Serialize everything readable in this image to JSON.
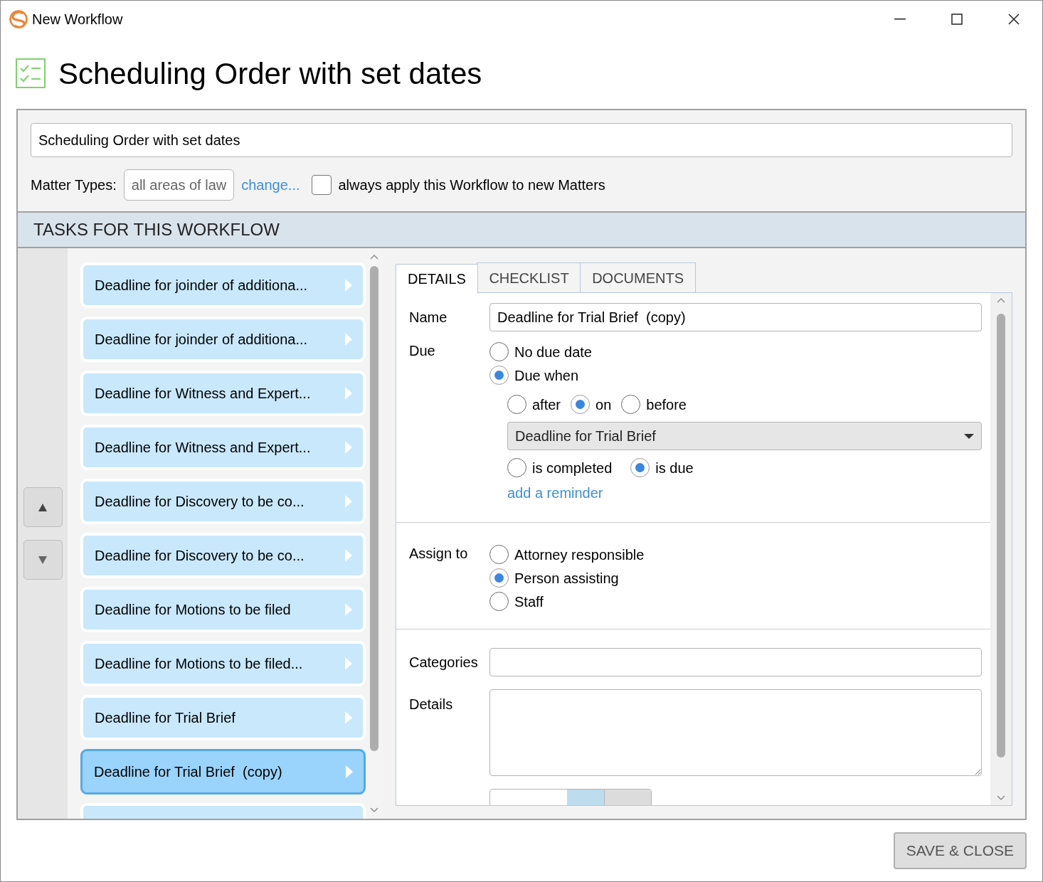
{
  "window": {
    "title": "New Workflow"
  },
  "heading": "Scheduling Order with set dates",
  "workflow_name": {
    "value": "Scheduling Order with set dates"
  },
  "matter_types": {
    "label": "Matter Types:",
    "value": "all areas of law",
    "change_link": "change...",
    "always_apply": {
      "label": "always apply this Workflow to new Matters",
      "checked": false
    }
  },
  "tasks_header": "TASKS FOR THIS WORKFLOW",
  "tasks": [
    {
      "label": "Deadline for joinder of additiona...",
      "selected": false
    },
    {
      "label": "Deadline for joinder of additiona...",
      "selected": false
    },
    {
      "label": "Deadline for Witness and Expert...",
      "selected": false
    },
    {
      "label": "Deadline for Witness and Expert...",
      "selected": false
    },
    {
      "label": "Deadline for Discovery to be co...",
      "selected": false
    },
    {
      "label": "Deadline for Discovery to be co...",
      "selected": false
    },
    {
      "label": "Deadline for Motions to be filed",
      "selected": false
    },
    {
      "label": "Deadline for Motions to be filed...",
      "selected": false
    },
    {
      "label": "Deadline for Trial Brief",
      "selected": false
    },
    {
      "label": "Deadline for Trial Brief  (copy)",
      "selected": true
    }
  ],
  "tabs": [
    {
      "label": "DETAILS",
      "selected": true
    },
    {
      "label": "CHECKLIST",
      "selected": false
    },
    {
      "label": "DOCUMENTS",
      "selected": false
    }
  ],
  "details": {
    "name_label": "Name",
    "name_value": "Deadline for Trial Brief  (copy)",
    "due_label": "Due",
    "due_options": [
      {
        "label": "No due date",
        "selected": false
      },
      {
        "label": "Due when",
        "selected": true
      }
    ],
    "relation_options": [
      {
        "label": "after",
        "selected": false
      },
      {
        "label": "on",
        "selected": true
      },
      {
        "label": "before",
        "selected": false
      }
    ],
    "due_task": "Deadline for Trial Brief",
    "condition_options": [
      {
        "label": "is completed",
        "selected": false
      },
      {
        "label": "is due",
        "selected": true
      }
    ],
    "reminder_link": "add a reminder",
    "assign_label": "Assign to",
    "assign_options": [
      {
        "label": "Attorney responsible",
        "selected": false
      },
      {
        "label": "Person assisting",
        "selected": true
      },
      {
        "label": "Staff",
        "selected": false
      }
    ],
    "categories_label": "Categories",
    "details_label": "Details",
    "duration_units": [
      {
        "selected": true
      },
      {
        "selected": false
      }
    ]
  },
  "save_button": "SAVE & CLOSE"
}
